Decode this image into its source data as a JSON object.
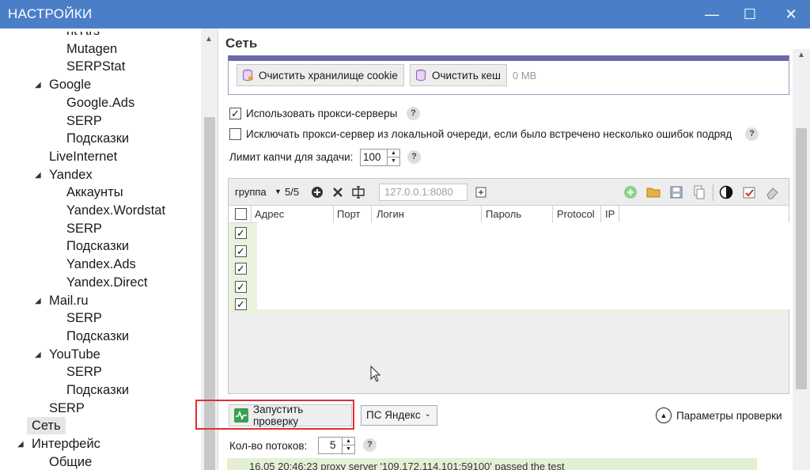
{
  "window": {
    "title": "НАСТРОЙКИ",
    "minimize": "—",
    "maximize": "☐",
    "close": "✕"
  },
  "tree": {
    "items": [
      {
        "label": "ntTtrs",
        "level": 3,
        "partial": true
      },
      {
        "label": "Mutagen",
        "level": 3
      },
      {
        "label": "SERPStat",
        "level": 3
      },
      {
        "label": "Google",
        "level": 2,
        "expanded": true
      },
      {
        "label": "Google.Ads",
        "level": 3
      },
      {
        "label": "SERP",
        "level": 3
      },
      {
        "label": "Подсказки",
        "level": 3
      },
      {
        "label": "LiveInternet",
        "level": 2
      },
      {
        "label": "Yandex",
        "level": 2,
        "expanded": true
      },
      {
        "label": "Аккаунты",
        "level": 3
      },
      {
        "label": "Yandex.Wordstat",
        "level": 3
      },
      {
        "label": "SERP",
        "level": 3
      },
      {
        "label": "Подсказки",
        "level": 3
      },
      {
        "label": "Yandex.Ads",
        "level": 3
      },
      {
        "label": "Yandex.Direct",
        "level": 3
      },
      {
        "label": "Mail.ru",
        "level": 2,
        "expanded": true
      },
      {
        "label": "SERP",
        "level": 3
      },
      {
        "label": "Подсказки",
        "level": 3
      },
      {
        "label": "YouTube",
        "level": 2,
        "expanded": true
      },
      {
        "label": "SERP",
        "level": 3
      },
      {
        "label": "Подсказки",
        "level": 3
      },
      {
        "label": "SERP",
        "level": 2
      },
      {
        "label": "Сеть",
        "level": 1,
        "selected": true
      },
      {
        "label": "Интерфейс",
        "level": 1,
        "expanded": true
      },
      {
        "label": "Общие",
        "level": 2
      }
    ]
  },
  "panel": {
    "title": "Сеть",
    "clear_cookie_label": "Очистить хранилище cookie",
    "clear_cache_label": "Очистить кеш",
    "cache_size": "0 MB",
    "use_proxy_label": "Использовать прокси-серверы",
    "use_proxy_checked": true,
    "exclude_proxy_label": "Исключать прокси-сервер из локальной очереди, если было встречено несколько ошибок подряд",
    "exclude_proxy_checked": false,
    "captcha_limit_label": "Лимит капчи для задачи:",
    "captcha_limit_value": "100",
    "help_mark": "?"
  },
  "proxy_grid": {
    "group_label": "группа",
    "count": "5/5",
    "ip_placeholder": "127.0.0.1:8080",
    "columns": [
      "Адрес",
      "Порт",
      "Логин",
      "Пароль",
      "Protocol",
      "IP"
    ],
    "rows": [
      {
        "checked": true
      },
      {
        "checked": true
      },
      {
        "checked": true
      },
      {
        "checked": true
      },
      {
        "checked": true
      }
    ]
  },
  "bottom": {
    "start_check_label": "Запустить проверку",
    "engine_select": "ПС Яндекс",
    "check_params_label": "Параметры проверки",
    "threads_label": "Кол-во потоков:",
    "threads_value": "5",
    "log_line": "16.05 20:46:23  proxy server '109.172.114.101:59100' passed the test"
  },
  "colors": {
    "titlebar": "#4a7fc7",
    "row_highlight": "#e9f2dc",
    "annotation_red": "#e03030"
  }
}
